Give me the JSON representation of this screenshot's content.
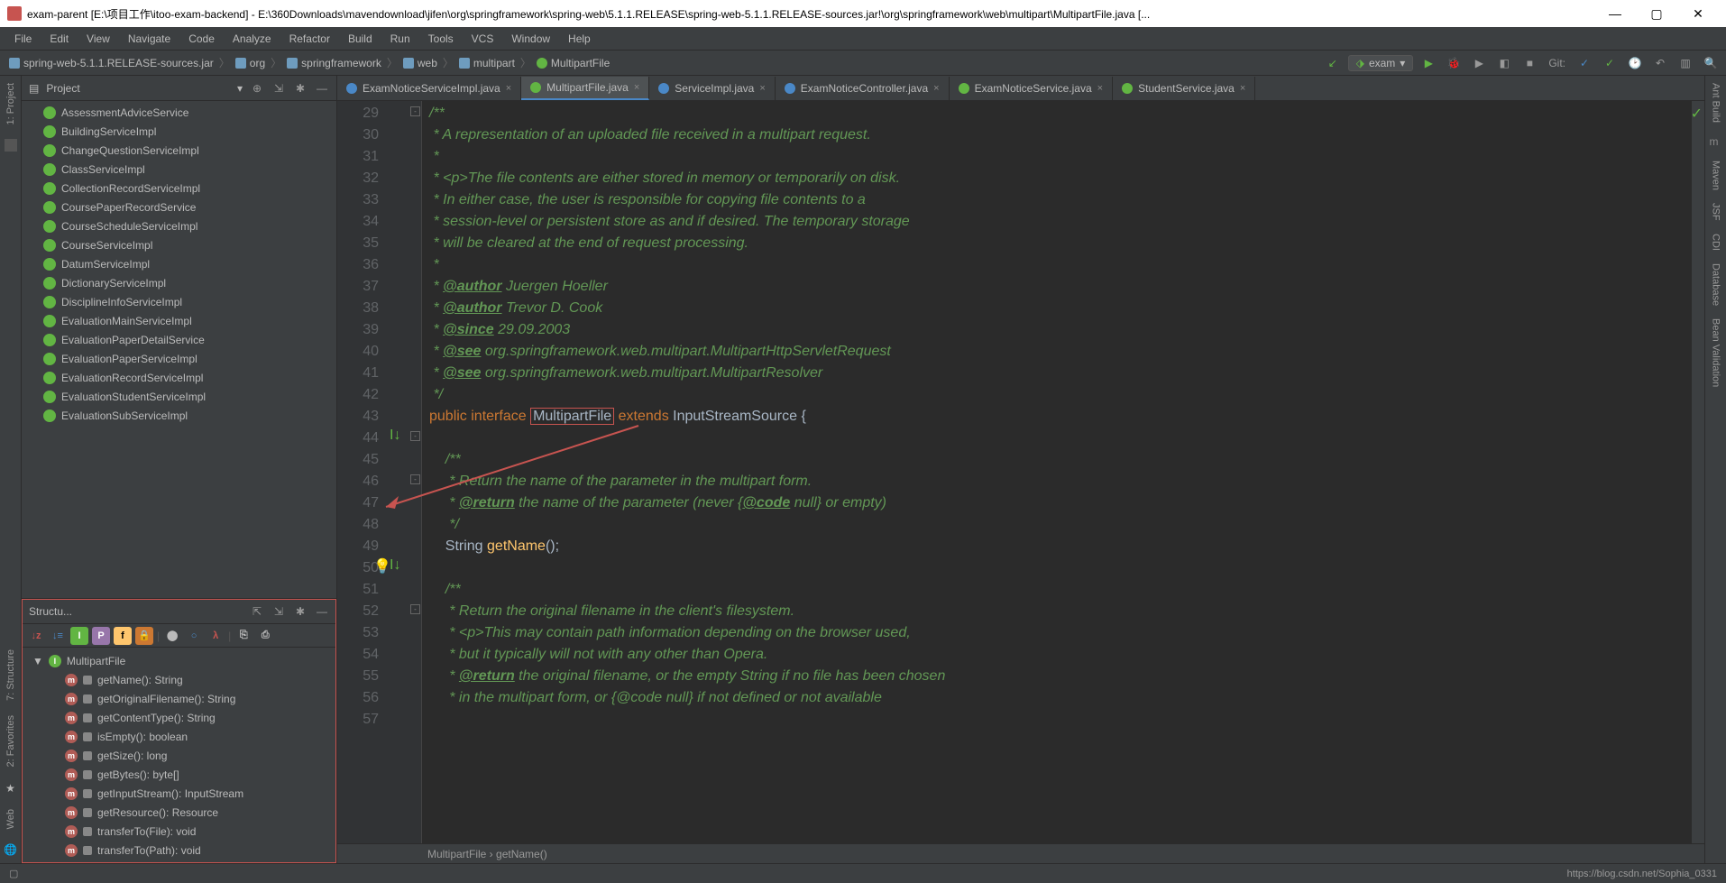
{
  "title": "exam-parent [E:\\项目工作\\itoo-exam-backend] - E:\\360Downloads\\mavendownload\\jifen\\org\\springframework\\spring-web\\5.1.1.RELEASE\\spring-web-5.1.1.RELEASE-sources.jar!\\org\\springframework\\web\\multipart\\MultipartFile.java [...",
  "menu": [
    "File",
    "Edit",
    "View",
    "Navigate",
    "Code",
    "Analyze",
    "Refactor",
    "Build",
    "Run",
    "Tools",
    "VCS",
    "Window",
    "Help"
  ],
  "breadcrumbs": [
    "spring-web-5.1.1.RELEASE-sources.jar",
    "org",
    "springframework",
    "web",
    "multipart",
    "MultipartFile"
  ],
  "runConfig": "exam",
  "gitLabel": "Git:",
  "projectPanel": {
    "title": "Project"
  },
  "projectItems": [
    "AssessmentAdviceService",
    "BuildingServiceImpl",
    "ChangeQuestionServiceImpl",
    "ClassServiceImpl",
    "CollectionRecordServiceImpl",
    "CoursePaperRecordService",
    "CourseScheduleServiceImpl",
    "CourseServiceImpl",
    "DatumServiceImpl",
    "DictionaryServiceImpl",
    "DisciplineInfoServiceImpl",
    "EvaluationMainServiceImpl",
    "EvaluationPaperDetailService",
    "EvaluationPaperServiceImpl",
    "EvaluationRecordServiceImpl",
    "EvaluationStudentServiceImpl",
    "EvaluationSubServiceImpl"
  ],
  "structurePanel": {
    "title": "Structu..."
  },
  "structureRoot": "MultipartFile",
  "structureItems": [
    "getName(): String",
    "getOriginalFilename(): String",
    "getContentType(): String",
    "isEmpty(): boolean",
    "getSize(): long",
    "getBytes(): byte[]",
    "getInputStream(): InputStream",
    "getResource(): Resource",
    "transferTo(File): void",
    "transferTo(Path): void"
  ],
  "tabs": [
    {
      "label": "ExamNoticeServiceImpl.java",
      "type": "c"
    },
    {
      "label": "MultipartFile.java",
      "type": "i",
      "active": true
    },
    {
      "label": "ServiceImpl.java",
      "type": "c"
    },
    {
      "label": "ExamNoticeController.java",
      "type": "c"
    },
    {
      "label": "ExamNoticeService.java",
      "type": "i"
    },
    {
      "label": "StudentService.java",
      "type": "i"
    }
  ],
  "lineStart": 29,
  "lineEnd": 57,
  "breadcrumbBottom": "MultipartFile  ›  getName()",
  "footer": "https://blog.csdn.net/Sophia_0331",
  "leftTools": {
    "project": "1: Project",
    "structure": "7: Structure",
    "fav": "2: Favorites",
    "web": "Web"
  },
  "rightTools": [
    "Ant Build",
    "Maven",
    "JSF",
    "CDI",
    "Database",
    "Bean Validation"
  ]
}
